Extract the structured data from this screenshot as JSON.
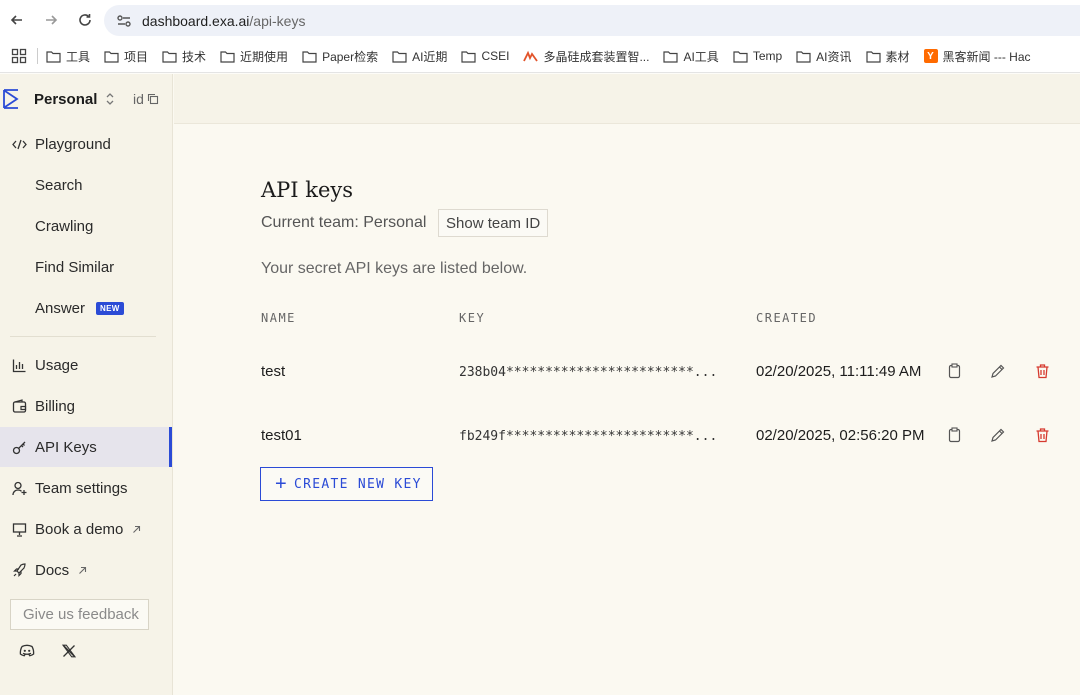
{
  "browser": {
    "url_host": "dashboard.exa.ai",
    "url_path": "/api-keys",
    "bookmarks": [
      {
        "label": "工具",
        "icon": "folder-icon"
      },
      {
        "label": "项目",
        "icon": "folder-icon"
      },
      {
        "label": "技术",
        "icon": "folder-icon"
      },
      {
        "label": "近期使用",
        "icon": "folder-icon"
      },
      {
        "label": "Paper检索",
        "icon": "folder-icon"
      },
      {
        "label": "AI近期",
        "icon": "folder-icon"
      },
      {
        "label": "CSEI",
        "icon": "folder-icon"
      },
      {
        "label": "多晶硅成套装置智...",
        "icon": "site-favicon"
      },
      {
        "label": "AI工具",
        "icon": "folder-icon"
      },
      {
        "label": "Temp",
        "icon": "folder-icon"
      },
      {
        "label": "AI资讯",
        "icon": "folder-icon"
      },
      {
        "label": "素材",
        "icon": "folder-icon"
      },
      {
        "label": "黑客新闻 --- Hac",
        "icon": "ycombinator-favicon"
      }
    ],
    "ycomb_letter": "Y"
  },
  "sidebar": {
    "team_name": "Personal",
    "id_label": "id",
    "items": [
      {
        "label": "Playground",
        "icon": "code-icon"
      },
      {
        "label": "Search"
      },
      {
        "label": "Crawling"
      },
      {
        "label": "Find Similar"
      },
      {
        "label": "Answer",
        "badge": "NEW"
      },
      {
        "label": "Usage",
        "icon": "chart-icon"
      },
      {
        "label": "Billing",
        "icon": "wallet-icon"
      },
      {
        "label": "API Keys",
        "icon": "key-icon",
        "active": true
      },
      {
        "label": "Team settings",
        "icon": "user-plus-icon"
      },
      {
        "label": "Book a demo",
        "icon": "presentation-icon",
        "external": true
      },
      {
        "label": "Docs",
        "icon": "rocket-icon",
        "external": true
      }
    ],
    "feedback_placeholder": "Give us feedback"
  },
  "main": {
    "title": "API keys",
    "team_line": "Current team: Personal",
    "show_team_id": "Show team ID",
    "subtext": "Your secret API keys are listed below.",
    "columns": [
      "NAME",
      "KEY",
      "CREATED"
    ],
    "rows": [
      {
        "name": "test",
        "key": "238b04************************...",
        "created": "02/20/2025, 11:11:49 AM"
      },
      {
        "name": "test01",
        "key": "fb249f************************...",
        "created": "02/20/2025, 02:56:20 PM"
      }
    ],
    "create_button": "CREATE NEW KEY"
  },
  "colors": {
    "accent": "#2b4bd6",
    "danger": "#d63a2f"
  }
}
